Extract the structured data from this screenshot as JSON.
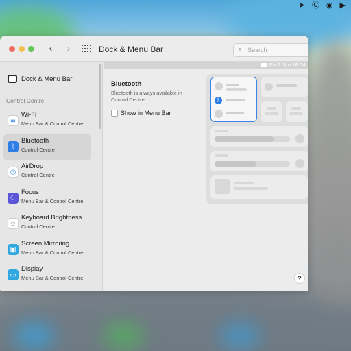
{
  "menubar": {
    "icons": [
      "location-icon",
      "g-icon",
      "airdrop-status-icon",
      "play-icon"
    ]
  },
  "window": {
    "title": "Dock & Menu Bar",
    "search_placeholder": "Search"
  },
  "sidebar": {
    "top_item": "Dock & Menu Bar",
    "section_label": "Control Centre",
    "items": [
      {
        "title": "Wi-Fi",
        "subtitle": "Menu Bar & Control Centre",
        "icon": "wifi-icon",
        "color": "#ffffff",
        "selected": false
      },
      {
        "title": "Bluetooth",
        "subtitle": "Control Centre",
        "icon": "bluetooth-icon",
        "color": "#2f7ee6",
        "selected": true
      },
      {
        "title": "AirDrop",
        "subtitle": "Control Centre",
        "icon": "airdrop-icon",
        "color": "#ffffff",
        "selected": false
      },
      {
        "title": "Focus",
        "subtitle": "Menu Bar & Control Centre",
        "icon": "moon-icon",
        "color": "#5b54d6",
        "selected": false
      },
      {
        "title": "Keyboard Brightness",
        "subtitle": "Control Centre",
        "icon": "keyboard-brightness-icon",
        "color": "#ffffff",
        "selected": false
      },
      {
        "title": "Screen Mirroring",
        "subtitle": "Menu Bar & Control Centre",
        "icon": "screen-mirroring-icon",
        "color": "#2fa8e0",
        "selected": false
      },
      {
        "title": "Display",
        "subtitle": "Menu Bar & Control Centre",
        "icon": "display-icon",
        "color": "#2fa8e0",
        "selected": false
      }
    ]
  },
  "main": {
    "preview_clock": "Fri 2 Jun  18:54",
    "section_title": "Bluetooth",
    "section_description": "Bluetooth is always available in Control Centre.",
    "checkbox_label": "Show in Menu Bar",
    "checkbox_checked": false,
    "help_label": "?"
  }
}
